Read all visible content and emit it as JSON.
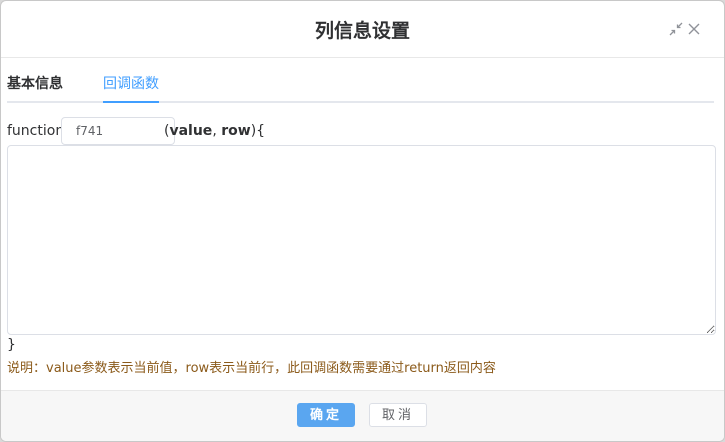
{
  "dialog": {
    "title": "列信息设置",
    "icons": {
      "shrink": "shrink-icon",
      "close": "close-icon"
    }
  },
  "tabs": [
    {
      "label": "基本信息",
      "active": false
    },
    {
      "label": "回调函数",
      "active": true
    }
  ],
  "callback": {
    "keyword": "function",
    "name_value": "f741",
    "params_open": "(",
    "param1": "value",
    "comma": ", ",
    "param2": "row",
    "params_close": "){",
    "body": "",
    "close_brace": "}",
    "note": "说明：value参数表示当前值，row表示当前行，此回调函数需要通过return返回内容"
  },
  "footer": {
    "ok_label": "确定",
    "cancel_label": "取消"
  },
  "colors": {
    "accent": "#409eff",
    "ok_button": "#5aa6f0",
    "note_text": "#8b5a1a"
  }
}
